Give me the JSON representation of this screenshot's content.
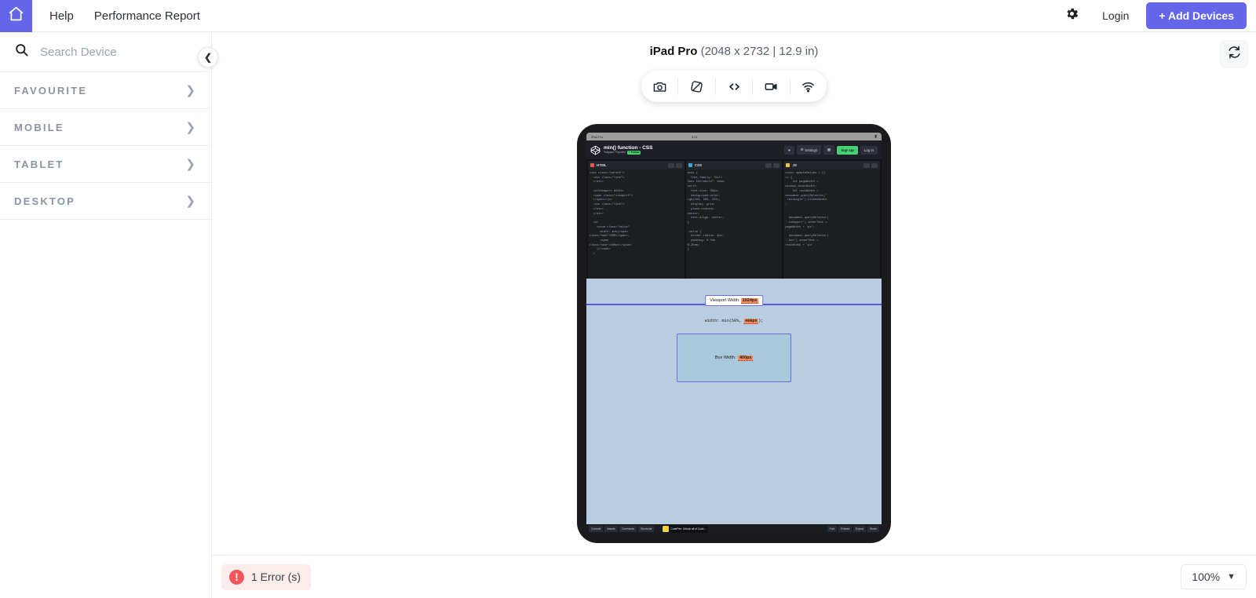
{
  "topbar": {
    "home_icon": "home-icon",
    "links": [
      "Help",
      "Performance Report"
    ],
    "gear_icon": "gear-icon",
    "login_label": "Login",
    "add_devices_label": "+ Add Devices",
    "accent_color": "#6366e8"
  },
  "sidebar": {
    "search_placeholder": "Search Device",
    "search_value": "",
    "search_icon": "search-icon",
    "collapse_icon": "chevron-left-icon",
    "categories": [
      {
        "label": "FAVOURITE",
        "chevron": "chevron-right-icon"
      },
      {
        "label": "MOBILE",
        "chevron": "chevron-right-icon"
      },
      {
        "label": "TABLET",
        "chevron": "chevron-right-icon"
      },
      {
        "label": "DESKTOP",
        "chevron": "chevron-right-icon"
      }
    ]
  },
  "main": {
    "device_name": "iPad Pro",
    "device_spec": "(2048 x 2732 | 12.9 in)",
    "refresh_icon": "refresh-icon",
    "tools": [
      {
        "name": "screenshot-icon",
        "label": "camera"
      },
      {
        "name": "rotate-icon",
        "label": "rotate"
      },
      {
        "name": "inspect-code-icon",
        "label": "code"
      },
      {
        "name": "record-video-icon",
        "label": "video"
      },
      {
        "name": "network-throttle-icon",
        "label": "wifi"
      }
    ]
  },
  "device_screen": {
    "ios_status": {
      "left": "iPad Pro",
      "wifi": "wifi-icon",
      "time": "9:41",
      "battery": "battery-icon"
    },
    "codepen": {
      "logo_icon": "codepen-logo-icon",
      "pen_title": "min() function - CSS",
      "author": "Satyam Tripathi",
      "follow_label": "+ Follow",
      "buttons": [
        {
          "label": "",
          "icon": "heart-icon",
          "style": "dark"
        },
        {
          "label": "Settings",
          "icon": "gear-icon",
          "style": "dark"
        },
        {
          "label": "",
          "icon": "save-icon",
          "style": "dark"
        },
        {
          "label": "Sign Up",
          "icon": "",
          "style": "green"
        },
        {
          "label": "Log In",
          "icon": "",
          "style": "dark"
        }
      ],
      "editors": [
        {
          "lang": "HTML",
          "dot_color": "#e4584f",
          "code": "<div class=\"parent\">\n  <div class=\"line\">\n  </div>\n\n  <p>Viewport Width:\n  <span class=\"viewport\">\n  </span></p>\n  <div class=\"line\">\n  </div>\n  </div>\n\n  <p>\n    <code class=\"value\"\n      width: min(<span\nclass=\"max\">50%</span>,\n      <span\nclass=\"min\">400px</span>\n    )</code>\n  >"
        },
        {
          "lang": "CSS",
          "dot_color": "#36a9e1",
          "code": "body {\n  font-family: \"Gill\nSans Extrabold\", sans-\nserif;\n  font-size: 30px;\n  background-color:\nrgb(184, 205, 224);\n  display: grid;\n  place-content:\ncenter;\n  text-align: center;\n}\n\n.value {\n  border-radius: 8px;\n  padding: 0.5em\n0.25em;\n}"
        },
        {
          "lang": "JS",
          "dot_color": "#f0c63c",
          "code": "const updateValues = ()\n=> {\n    let pageWidth =\nwindow.innerWidth;\n    let rectWidth =\ndocument.querySelector('\n.rectangle').clientWidth\n;\n\n\n  document.querySelector(\n'.viewport').innerText =\npageWidth + 'px';\n\n  document.querySelector(\n'.box').innerText =\nrectWidth + 'px'"
        }
      ],
      "preview": {
        "viewport_label": "Viewport Width:",
        "viewport_value": "1024px",
        "width_rule": "width: min(50%, 400px);",
        "width_rule_highlight": "400px",
        "box_label": "Box Width:",
        "box_value": "400px"
      },
      "footer": {
        "left_buttons": [
          "Console",
          "Assets",
          "Comments",
          "Shortcuts"
        ],
        "promo_text": "CodePen: Unlock all of Code...",
        "right_buttons": [
          "Fork",
          "Embed",
          "Export",
          "Share"
        ]
      }
    }
  },
  "bottombar": {
    "error_icon": "error-icon",
    "error_text": "1 Error (s)",
    "error_color": "#f2555a",
    "zoom_value": "100%",
    "zoom_chevron": "chevron-down-icon"
  }
}
